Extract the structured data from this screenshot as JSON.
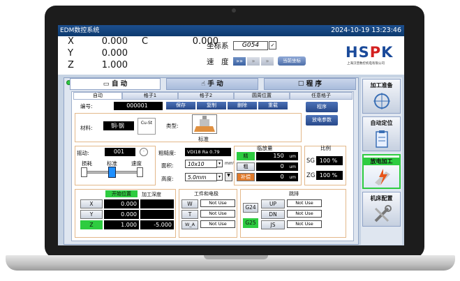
{
  "app": {
    "title": "EDM数控系统",
    "datetime": "2024-10-19  13:23:46"
  },
  "coords": {
    "x_label": "X",
    "x_value": "0.000",
    "y_label": "Y",
    "y_value": "0.000",
    "z_label": "Z",
    "z_value": "1.000",
    "c_label": "C",
    "c_value": "0.000",
    "system_label": "坐标系",
    "system_value": "G054",
    "speed_label": "速　度",
    "speed_marks": [
      "»»",
      "»",
      "»"
    ],
    "current_button": "当前坐标"
  },
  "logo": {
    "text_a": "HS",
    "text_b": "P",
    "text_c": "K",
    "subtitle": "上海汉普数控机电有限公司"
  },
  "main_tabs": [
    "自 动",
    "手 动",
    "程 序"
  ],
  "sub_tabs": [
    "自动",
    "格子1",
    "格子2",
    "圆周位置",
    "任意格子"
  ],
  "form": {
    "number_label": "编号:",
    "number_value": "000001",
    "actions": [
      "保存",
      "复制",
      "删除",
      "重载"
    ],
    "program_button": "程序",
    "discharge_button": "放电参数",
    "material_label": "材料:",
    "material_value": "铜-钢",
    "material_icon": "Cu-St",
    "type_label": "类型:",
    "type_value": "标准",
    "swing_label": "摇动:",
    "swing_value": "001",
    "loss_label": "损耗",
    "standard_label": "标准",
    "speed_label": "速度",
    "roughness_label": "粗糙度:",
    "roughness_value": "VDI18   Ra 0.79",
    "area_label": "面积:",
    "area_value": "10x10",
    "area_unit": "mm²",
    "height_label": "高度:",
    "height_value": "5.0mm",
    "allowance": {
      "title": "临放量",
      "rows": [
        {
          "label": "精",
          "value": "150",
          "unit": "um"
        },
        {
          "label": "粗",
          "value": "0",
          "unit": "um"
        },
        {
          "label": "补偿",
          "value": "0",
          "unit": "um"
        }
      ]
    },
    "ratio": {
      "title": "比例",
      "rows": [
        {
          "label": "SG",
          "value": "100 %"
        },
        {
          "label": "ZG",
          "value": "100 %"
        }
      ]
    },
    "position": {
      "start_header": "开始位置",
      "depth_header": "加工深度",
      "rows": [
        {
          "axis": "X",
          "start": "0.000",
          "depth": ""
        },
        {
          "axis": "Y",
          "start": "0.000",
          "depth": ""
        },
        {
          "axis": "Z",
          "start": "1.000",
          "depth": "-5.000"
        }
      ]
    },
    "workpiece": {
      "title": "工件和电极",
      "rows": [
        {
          "label": "W",
          "value": "Not Use"
        },
        {
          "label": "T",
          "value": "Not Use"
        },
        {
          "label": "W_A",
          "value": "Not Use"
        }
      ]
    },
    "jump": {
      "title": "跳排",
      "g24": "G24",
      "g25": "G25",
      "rows": [
        {
          "label": "UP",
          "value": "Not Use"
        },
        {
          "label": "DN",
          "value": "Not Use"
        },
        {
          "label": "JS",
          "value": "Not Use"
        }
      ]
    }
  },
  "right_menu": [
    "加工准备",
    "自动定位",
    "放电加工",
    "机床配置"
  ],
  "colors": {
    "title_bar": "#0d3a6e",
    "accent_blue": "#28498a",
    "active_green": "#2ecc40",
    "logo_blue": "#1a4a9a",
    "logo_red": "#d32020"
  }
}
